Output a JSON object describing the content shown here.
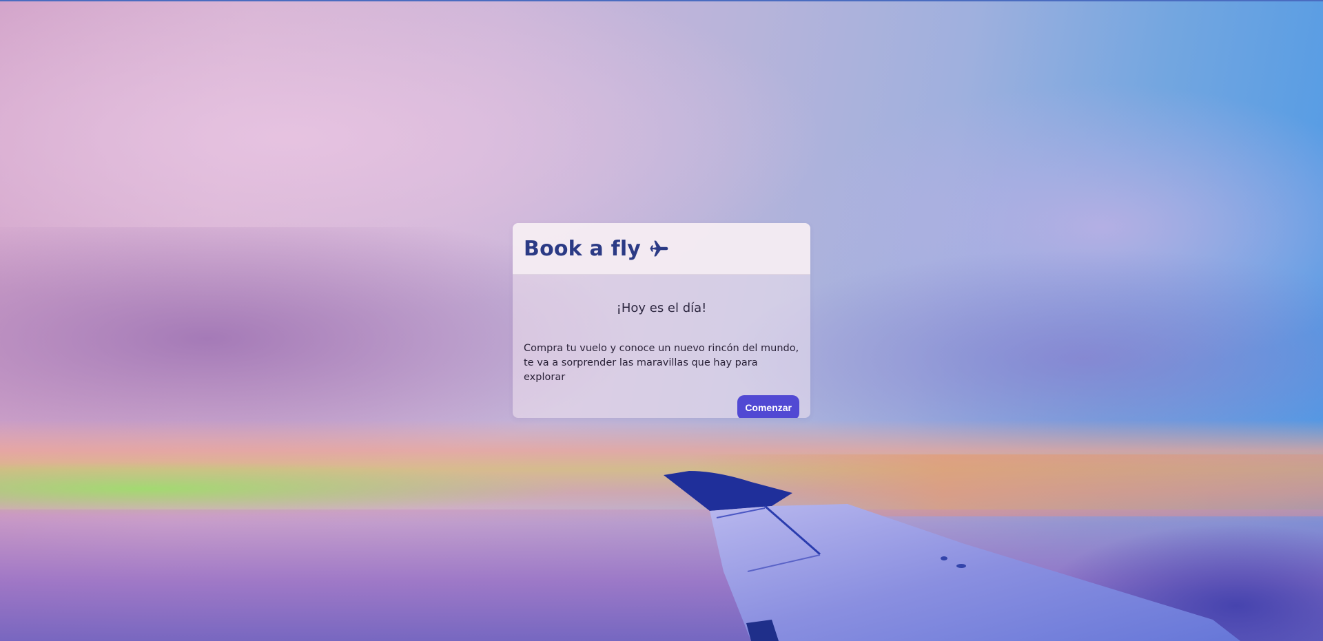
{
  "card": {
    "title": "Book a fly",
    "title_icon": "airplane-icon",
    "subtitle": "¡Hoy es el día!",
    "description_line1": "Compra tu vuelo y conoce un nuevo rincón del mundo,",
    "description_line2": "te va a sorprender las maravillas que hay para explorar",
    "button_label": "Comenzar"
  },
  "colors": {
    "title": "#2b3a85",
    "button_bg": "#5149d3",
    "button_text": "#ffffff"
  }
}
